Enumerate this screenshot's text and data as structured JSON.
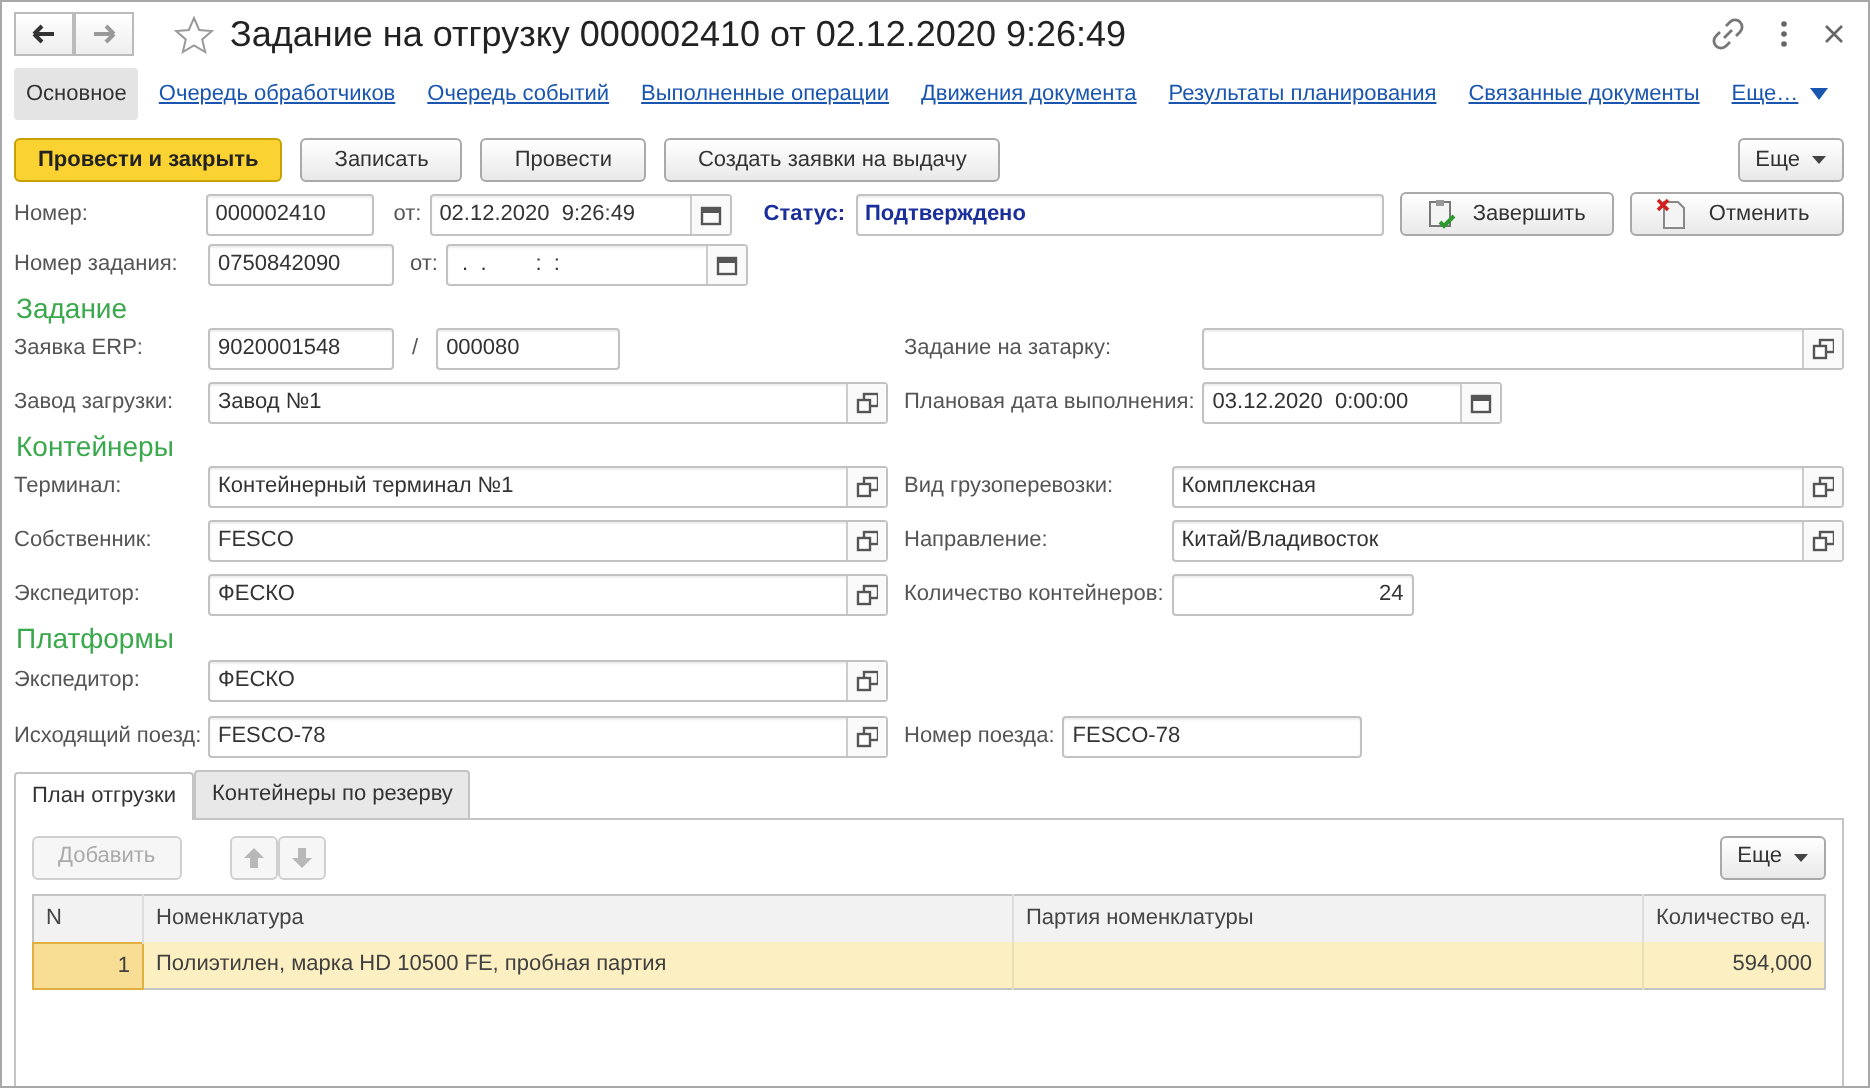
{
  "window": {
    "title": "Задание на отгрузку 000002410 от 02.12.2020 9:26:49",
    "favorite": false
  },
  "nav": [
    {
      "label": "Основное",
      "selected": true,
      "kind": "tab"
    },
    {
      "label": "Очередь обработчиков",
      "selected": false,
      "kind": "tab"
    },
    {
      "label": "Очередь событий",
      "selected": false,
      "kind": "tab"
    },
    {
      "label": "Выполненные операции",
      "selected": false,
      "kind": "tab"
    },
    {
      "label": "Движения документа",
      "selected": false,
      "kind": "tab"
    },
    {
      "label": "Результаты планирования",
      "selected": false,
      "kind": "tab"
    },
    {
      "label": "Связанные документы",
      "selected": false,
      "kind": "tab"
    },
    {
      "label": "Еще…",
      "kind": "more"
    }
  ],
  "toolbar": {
    "buttons": [
      {
        "label": "Провести и закрыть",
        "kind": "primary"
      },
      {
        "label": "Записать",
        "kind": "default"
      },
      {
        "label": "Провести",
        "kind": "default"
      },
      {
        "label": "Создать заявки на выдачу",
        "kind": "default"
      }
    ],
    "more": "Еще"
  },
  "header": {
    "number_label": "Номер:",
    "number": "000002410",
    "date_label": "от:",
    "date": "02.12.2020  9:26:49",
    "status_label": "Статус:",
    "status": "Подтверждено",
    "actions": [
      {
        "label": "Завершить",
        "kind": "complete"
      },
      {
        "label": "Отменить",
        "kind": "cancel"
      }
    ],
    "task_label": "Номер задания:",
    "task_number": "0750842090",
    "task_date_label": "от:",
    "task_date": " .  .        :  :"
  },
  "sections": [
    {
      "title": "Задание",
      "rows": [
        {
          "left": {
            "label": "Заявка ERP:",
            "kind": "pair",
            "values": [
              "9020001548",
              "000080"
            ],
            "separator": "/"
          },
          "right": {
            "label": "Задание на затарку:",
            "kind": "select"
          }
        },
        {
          "left": {
            "label": "Завод загрузки:",
            "kind": "select",
            "value": "Завод №1"
          },
          "right": {
            "label": "Плановая дата выполнения:",
            "kind": "date",
            "value": "03.12.2020  0:00:00"
          }
        }
      ]
    },
    {
      "title": "Контейнеры",
      "rows": [
        {
          "left": {
            "label": "Терминал:",
            "kind": "select",
            "value": "Контейнерный терминал №1"
          },
          "right": {
            "label": "Вид грузоперевозки:",
            "kind": "select",
            "value": "Комплексная"
          }
        },
        {
          "left": {
            "label": "Собственник:",
            "kind": "select",
            "value": "FESCO"
          },
          "right": {
            "label": "Направление:",
            "kind": "select",
            "value": "Китай/Владивосток"
          }
        },
        {
          "left": {
            "label": "Экспедитор:",
            "kind": "select",
            "value": "ФЕСКО"
          },
          "right": {
            "label": "Количество контейнеров:",
            "kind": "number",
            "value": "24"
          }
        }
      ]
    },
    {
      "title": "Платформы",
      "rows": [
        {
          "left": {
            "label": "Экспедитор:",
            "kind": "select",
            "value": "ФЕСКО"
          }
        },
        {
          "left": {
            "label": "Исходящий поезд:",
            "kind": "select",
            "value": "FESCO-78"
          },
          "right": {
            "label": "Номер поезда:",
            "kind": "text",
            "value": "FESCO-78"
          }
        }
      ]
    }
  ],
  "tabs": [
    {
      "label": "План отгрузки",
      "selected": true
    },
    {
      "label": "Контейнеры по резерву",
      "selected": false
    }
  ],
  "table_toolbar": {
    "add": {
      "label": "Добавить",
      "disabled": true
    },
    "move_disabled": true,
    "more": "Еще"
  },
  "table": {
    "columns": [
      "N",
      "Номенклатура",
      "Партия номенклатуры",
      "Количество ед."
    ],
    "rows": [
      {
        "cells": [
          "1",
          "Полиэтилен, марка HD 10500 FE, пробная партия",
          "",
          "594,000"
        ],
        "selected": true
      }
    ]
  }
}
